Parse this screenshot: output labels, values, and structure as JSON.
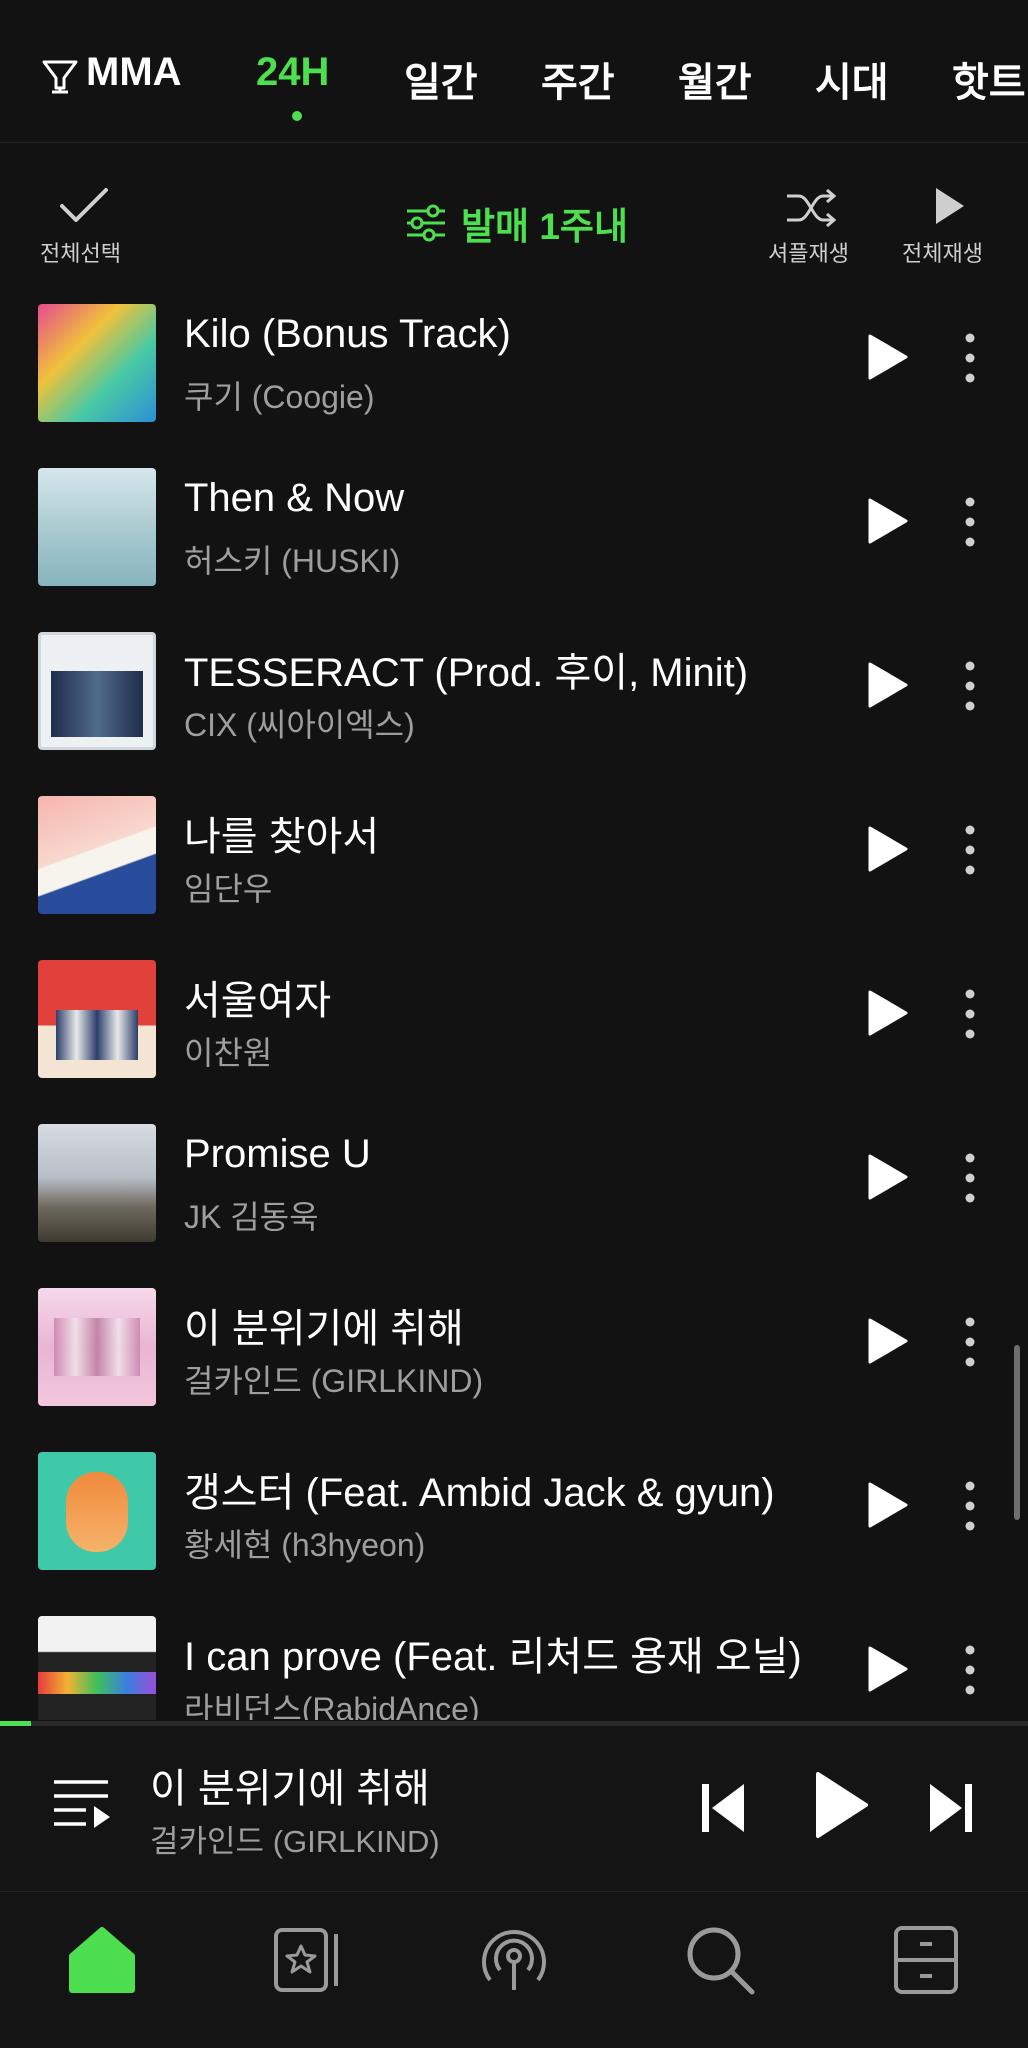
{
  "tabs": [
    {
      "label": "MMA",
      "icon": "trophy-icon"
    },
    {
      "label": "24H",
      "active": true
    },
    {
      "label": "일간"
    },
    {
      "label": "주간"
    },
    {
      "label": "월간"
    },
    {
      "label": "시대"
    },
    {
      "label": "핫트"
    }
  ],
  "actions": {
    "select_all": "전체선택",
    "filter": "발매 1주내",
    "shuffle": "셔플재생",
    "play_all": "전체재생"
  },
  "songs": [
    {
      "title": "Kilo (Bonus Track)",
      "artist": "쿠기 (Coogie)"
    },
    {
      "title": "Then & Now",
      "artist": "허스키 (HUSKI)"
    },
    {
      "title": "TESSERACT (Prod. 후이, Minit)",
      "artist": "CIX (씨아이엑스)"
    },
    {
      "title": "나를 찾아서",
      "artist": "임단우"
    },
    {
      "title": "서울여자",
      "artist": "이찬원"
    },
    {
      "title": "Promise U",
      "artist": "JK 김동욱"
    },
    {
      "title": "이 분위기에 취해",
      "artist": "걸카인드 (GIRLKIND)"
    },
    {
      "title": "갱스터 (Feat. Ambid Jack & gyun)",
      "artist": "황세현 (h3hyeon)"
    },
    {
      "title": "I can prove (Feat. 리처드 용재 오닐)",
      "artist": "라비던스(RabidAnce)"
    }
  ],
  "now_playing": {
    "title": "이 분위기에 취해",
    "artist": "걸카인드 (GIRLKIND)",
    "progress": 0.03
  },
  "nav": [
    "home-icon",
    "playlist-star-icon",
    "podcast-icon",
    "search-icon",
    "library-icon"
  ],
  "colors": {
    "accent": "#4ddf4f",
    "background": "#121212",
    "secondary_text": "#9e9e9e"
  }
}
